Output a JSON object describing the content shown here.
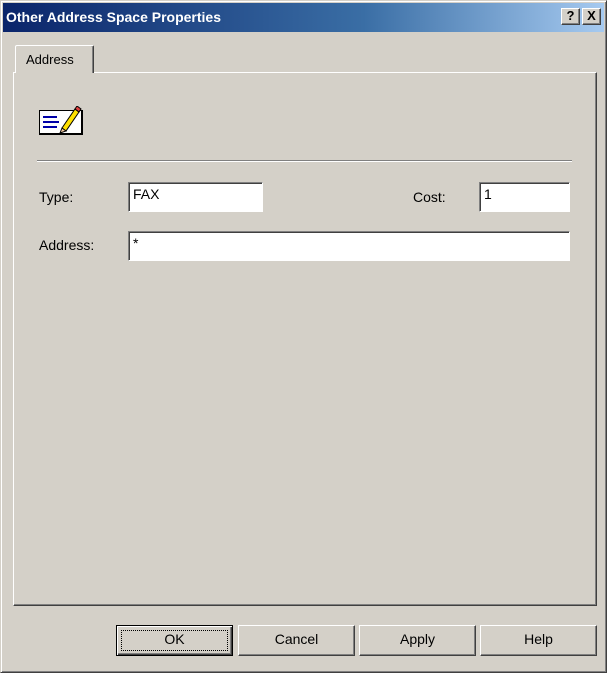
{
  "window": {
    "title": "Other Address Space Properties",
    "help_button_label": "?",
    "close_button_label": "X"
  },
  "tabs": [
    {
      "label": "Address",
      "selected": true
    }
  ],
  "form": {
    "type_label": "Type:",
    "type_value": "FAX",
    "cost_label": "Cost:",
    "cost_value": "1",
    "address_label": "Address:",
    "address_value": "*"
  },
  "buttons": {
    "ok": "OK",
    "cancel": "Cancel",
    "apply": "Apply",
    "help": "Help"
  },
  "icons": {
    "address_icon": "address-edit-icon"
  },
  "colors": {
    "face": "#d4d0c8",
    "titlebar_start": "#0a246a",
    "titlebar_end": "#a6caf0"
  }
}
